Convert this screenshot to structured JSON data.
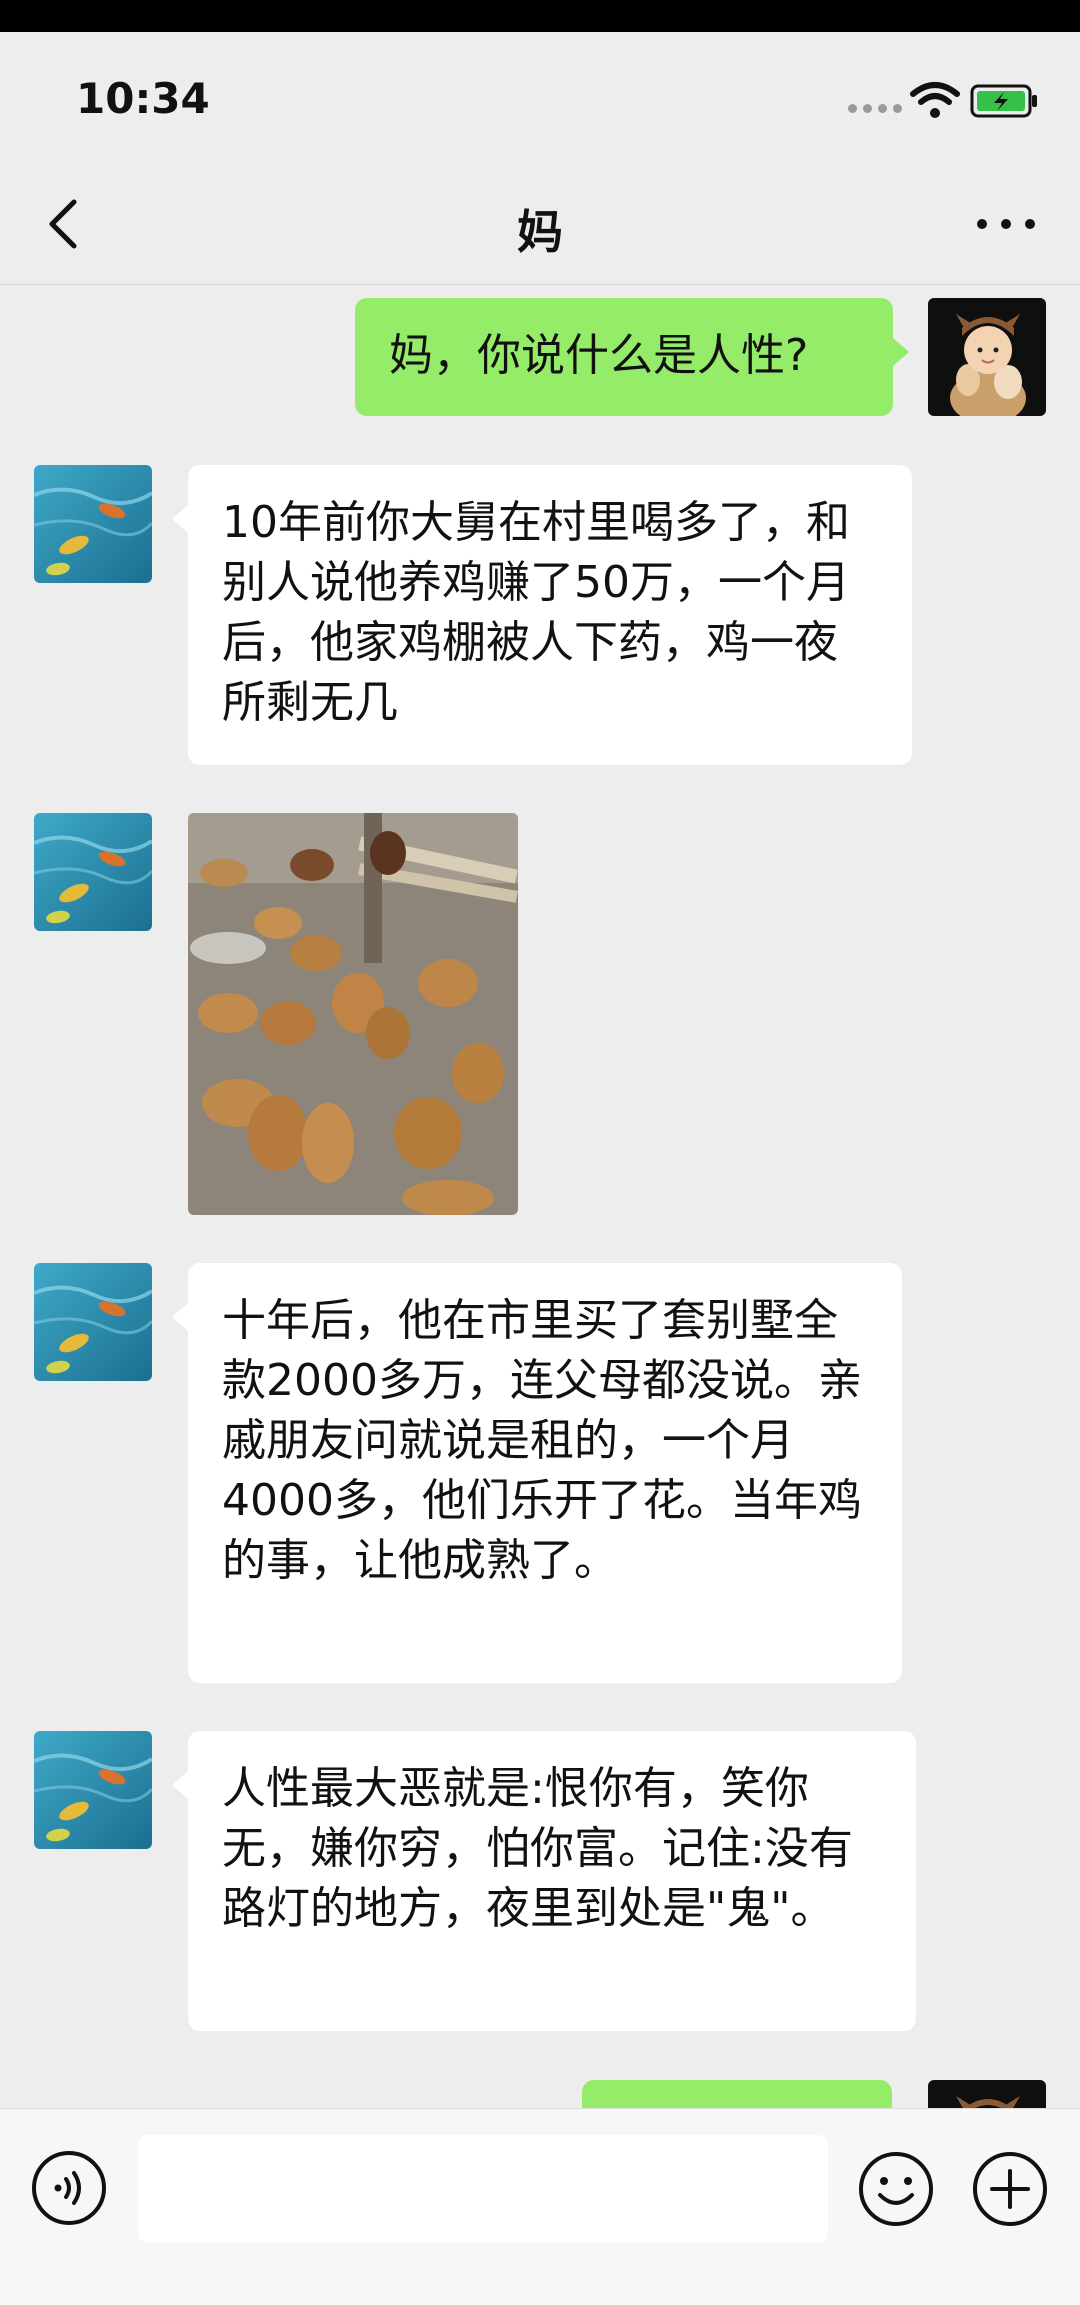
{
  "status_bar": {
    "time": "10:34"
  },
  "header": {
    "title": "妈"
  },
  "messages": [
    {
      "side": "right",
      "text": "妈，你说什么是人性?"
    },
    {
      "side": "left",
      "text": "10年前你大舅在村里喝多了，和别人说他养鸡赚了50万，一个月后，他家鸡棚被人下药，鸡一夜所剩无几"
    },
    {
      "side": "left",
      "type": "image",
      "image": "chickens-photo"
    },
    {
      "side": "left",
      "text": "十年后，他在市里买了套别墅全款2000多万，连父母都没说。亲戚朋友问就说是租的，一个月4000多，他们乐开了花。当年鸡的事，让他成熟了。"
    },
    {
      "side": "left",
      "text": "人性最大恶就是:恨你有，笑你无，嫌你穷，怕你富。记住:没有路灯的地方，夜里到处是\"鬼\"。"
    },
    {
      "side": "right",
      "text": ""
    }
  ],
  "colors": {
    "background": "#ededed",
    "bubble_self": "#95ec69",
    "bubble_other": "#ffffff"
  }
}
